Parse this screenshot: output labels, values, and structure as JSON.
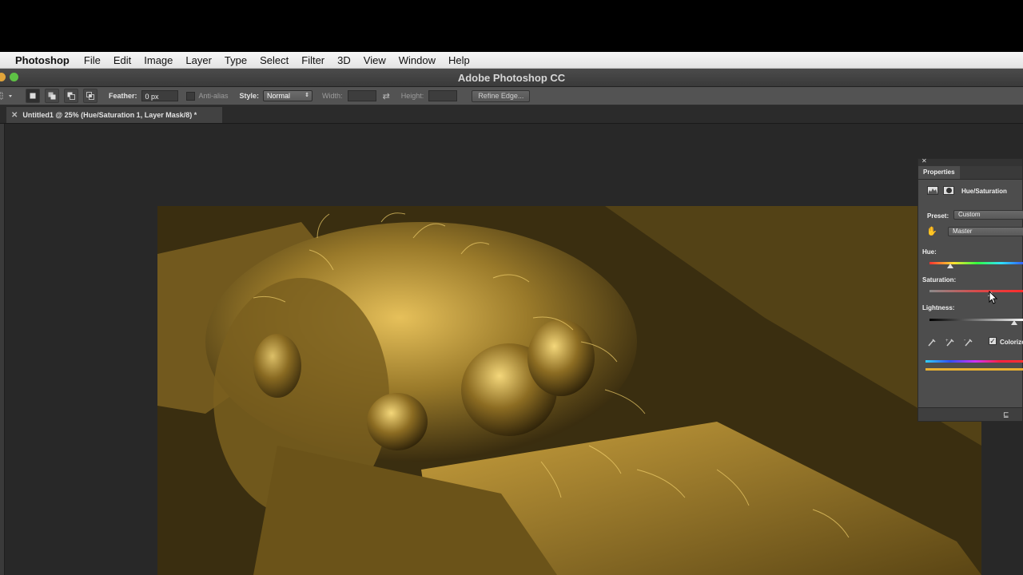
{
  "menubar": {
    "app_name": "Photoshop",
    "items": [
      "File",
      "Edit",
      "Image",
      "Layer",
      "Type",
      "Select",
      "Filter",
      "3D",
      "View",
      "Window",
      "Help"
    ]
  },
  "window": {
    "title": "Adobe Photoshop CC"
  },
  "options_bar": {
    "feather_label": "Feather:",
    "feather_value": "0 px",
    "antialias_label": "Anti-alias",
    "style_label": "Style:",
    "style_value": "Normal",
    "width_label": "Width:",
    "height_label": "Height:",
    "refine_edge_label": "Refine Edge..."
  },
  "document_tab": {
    "title": "Untitled1 @ 25% (Hue/Saturation 1, Layer Mask/8) *"
  },
  "properties_panel": {
    "tab_label": "Properties",
    "adjustment_name": "Hue/Saturation",
    "preset_label": "Preset:",
    "preset_value": "Custom",
    "channel_value": "Master",
    "hue_label": "Hue:",
    "saturation_label": "Saturation:",
    "lightness_label": "Lightness:",
    "colorize_label": "Colorize",
    "colorize_checked": true,
    "hue_level": 0.22,
    "saturation_level": 0.64,
    "lightness_level": 0.88
  },
  "colors": {
    "canvas_tint": "#c9a23c",
    "workspace": "#282828",
    "panel": "#4d4d4d"
  }
}
